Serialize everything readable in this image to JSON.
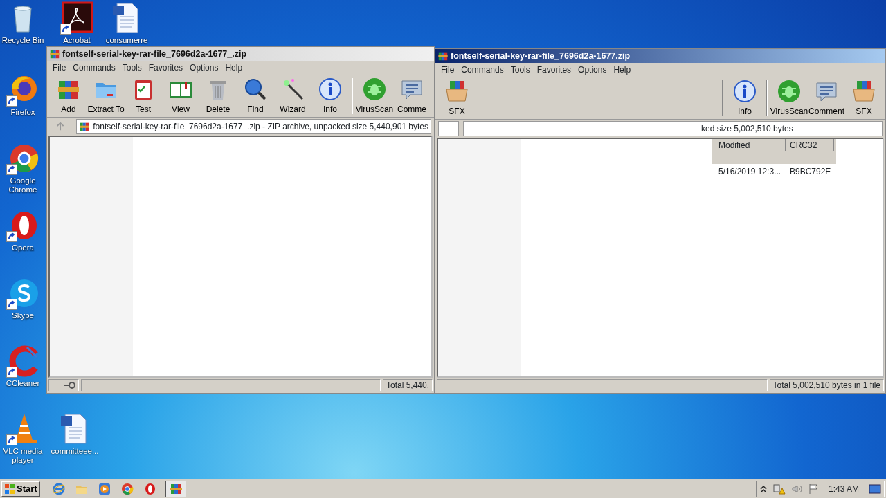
{
  "desktop_icons": [
    {
      "label": "Recycle Bin",
      "kind": "recycle",
      "shortcut": false
    },
    {
      "label": "Acrobat",
      "kind": "acrobat",
      "shortcut": true
    },
    {
      "label": "consumerre",
      "kind": "word",
      "shortcut": false
    },
    {
      "label": "Firefox",
      "kind": "firefox",
      "shortcut": true
    },
    {
      "label": "Google Chrome",
      "kind": "chrome",
      "shortcut": true
    },
    {
      "label": "Opera",
      "kind": "opera",
      "shortcut": true
    },
    {
      "label": "Skype",
      "kind": "skype",
      "shortcut": true
    },
    {
      "label": "CCleaner",
      "kind": "ccleaner",
      "shortcut": true
    },
    {
      "label": "VLC media player",
      "kind": "vlc",
      "shortcut": true
    },
    {
      "label": "committeee...",
      "kind": "word",
      "shortcut": false
    }
  ],
  "windows": [
    {
      "title": "fontself-serial-key-rar-file_7696d2a-1677_.zip",
      "active": false,
      "menu": [
        "File",
        "Commands",
        "Tools",
        "Favorites",
        "Options",
        "Help"
      ],
      "toolbar_groups": [
        [
          {
            "label": "Add",
            "kind": "add"
          },
          {
            "label": "Extract To",
            "kind": "extract"
          },
          {
            "label": "Test",
            "kind": "test"
          },
          {
            "label": "View",
            "kind": "view"
          },
          {
            "label": "Delete",
            "kind": "delete"
          },
          {
            "label": "Find",
            "kind": "find"
          },
          {
            "label": "Wizard",
            "kind": "wizard"
          },
          {
            "label": "Info",
            "kind": "info"
          }
        ],
        [
          {
            "label": "VirusScan",
            "kind": "virusscan"
          },
          {
            "label": "Comme",
            "kind": "comment"
          }
        ]
      ],
      "address": "fontself-serial-key-rar-file_7696d2a-1677_.zip - ZIP archive, unpacked size 5,440,901 bytes",
      "status": "Total 5,440,"
    },
    {
      "title": "fontself-serial-key-rar-file_7696d2a-1677.zip",
      "active": true,
      "menu": [
        "File",
        "Commands",
        "Tools",
        "Favorites",
        "Options",
        "Help"
      ],
      "toolbar_groups": [
        [
          {
            "label": "SFX",
            "kind": "sfx"
          }
        ],
        [
          {
            "label": "Info",
            "kind": "info"
          }
        ],
        [
          {
            "label": "VirusScan",
            "kind": "virusscan"
          },
          {
            "label": "Comment",
            "kind": "comment"
          },
          {
            "label": "SFX",
            "kind": "sfx"
          }
        ]
      ],
      "address": "ked size 5,002,510 bytes",
      "columns": [
        "Modified",
        "CRC32"
      ],
      "rows": [
        [
          "5/16/2019 12:3...",
          "B9BC792E"
        ]
      ],
      "status": "Total 5,002,510 bytes in 1 file"
    }
  ],
  "taskbar": {
    "start": "Start",
    "apps": [
      {
        "kind": "ie",
        "selected": false
      },
      {
        "kind": "explorer",
        "selected": false
      },
      {
        "kind": "media",
        "selected": false
      },
      {
        "kind": "chrome",
        "selected": false
      },
      {
        "kind": "opera",
        "selected": false
      },
      {
        "kind": "winrar",
        "selected": true
      }
    ],
    "clock": "1:43 AM"
  }
}
